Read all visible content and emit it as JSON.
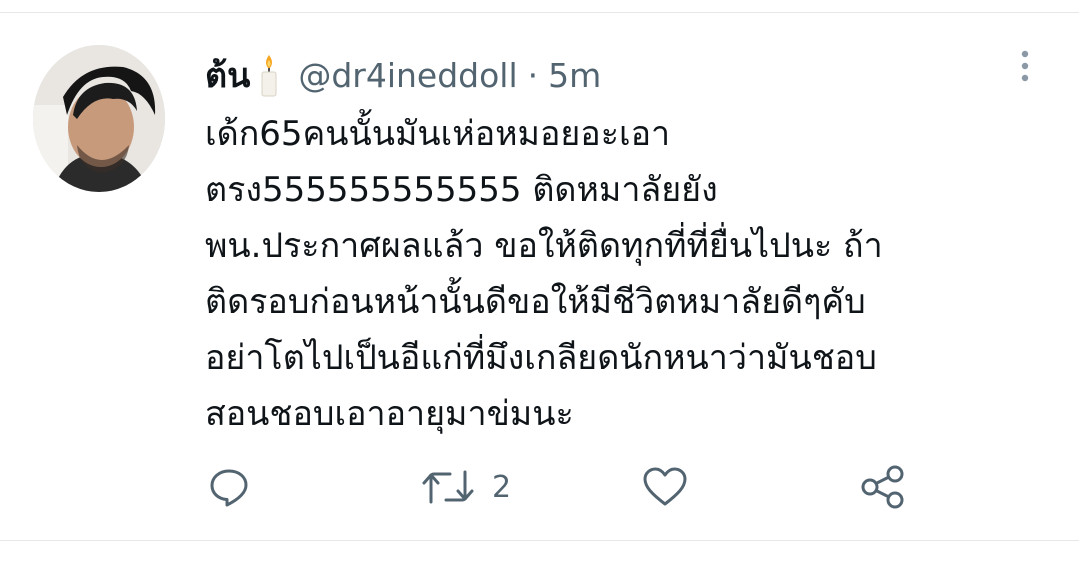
{
  "tweet": {
    "display_name": "ต้น",
    "name_emoji": "candle-icon",
    "handle": "@dr4ineddoll",
    "separator": "·",
    "time": "5m",
    "text": "เด้ก65คนนั้นมันเห่อหมอยอะเอา\nตรง555555555555 ติดหมาลัยยัง\nพน.ประกาศผลแล้ว ขอให้ติดทุกที่ที่ยื่นไปนะ ถ้า\nติดรอบก่อนหน้านั้นดีขอให้มีชีวิตหมาลัยดีๆคับ\nอย่าโตไปเป็นอีแก่ที่มึงเกลียดนักหนาว่ามันชอบ\nสอนชอบเอาอายุมาข่มนะ"
  },
  "actions": {
    "reply_icon": "reply-icon",
    "retweet_icon": "retweet-icon",
    "retweet_count": "2",
    "like_icon": "heart-icon",
    "share_icon": "share-icon"
  },
  "colors": {
    "text": "#0f1419",
    "secondary": "#536471",
    "divider": "#e7e7e7"
  }
}
